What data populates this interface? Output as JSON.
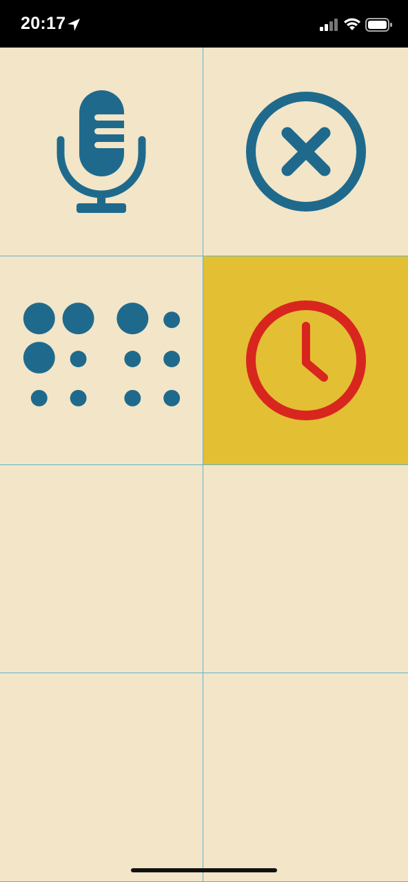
{
  "status_bar": {
    "time": "20:17",
    "icons": [
      "location-arrow-icon",
      "cellular-signal-icon",
      "wifi-icon",
      "battery-icon"
    ]
  },
  "grid": {
    "cells": [
      {
        "icon": "microphone-icon",
        "selected": false
      },
      {
        "icon": "close-circle-icon",
        "selected": false
      },
      {
        "icon": "braille-icon",
        "selected": false
      },
      {
        "icon": "clock-icon",
        "selected": true
      },
      {
        "icon": null,
        "selected": false
      },
      {
        "icon": null,
        "selected": false
      },
      {
        "icon": null,
        "selected": false
      },
      {
        "icon": null,
        "selected": false
      }
    ]
  },
  "colors": {
    "background": "#f2e5c8",
    "icon_primary": "#1f6a8c",
    "selected_cell": "#e3bf34",
    "selected_icon": "#d8261f",
    "grid_line": "#5fb3c9"
  }
}
